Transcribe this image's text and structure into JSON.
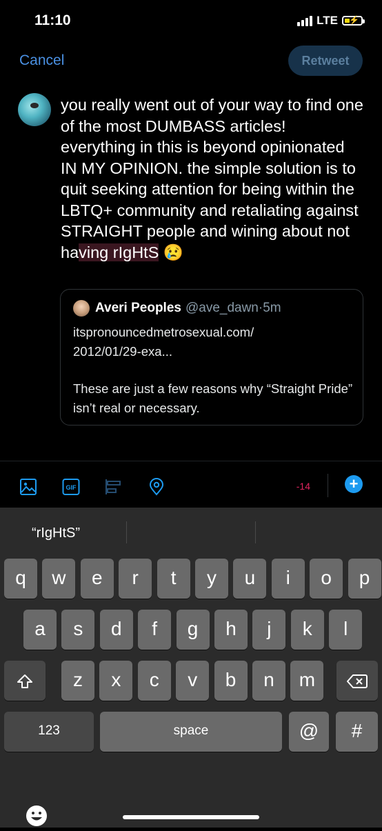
{
  "status": {
    "time": "11:10",
    "network": "LTE",
    "battery_level": 0.3,
    "battery_color": "#f5d90a"
  },
  "header": {
    "cancel_label": "Cancel",
    "retweet_label": "Retweet"
  },
  "composer": {
    "avatar_icon": "user-avatar",
    "text_main": "you really went out of your way to find one of the most DUMBASS articles! everything in this is beyond opinionated IN MY OPINION.  the simple solution is to quit seeking attention for being within the LBTQ+ community and retaliating against STRAIGHT people and wining about not ha",
    "text_highlight": "ving rIgHtS",
    "emoji": "😢"
  },
  "quote": {
    "name": "Averi Peoples",
    "handle": "@ave_dawn",
    "separator": "·",
    "time": "5m",
    "link_line1": "itspronouncedmetrosexual.com/",
    "link_line2": "2012/01/29-exa...",
    "body": "These are just a few reasons why “Straight Pride” isn’t real or necessary."
  },
  "toolbar": {
    "icons": [
      "image-icon",
      "gif-icon",
      "poll-icon",
      "location-icon"
    ],
    "gif_label": "GIF",
    "counter": "-14",
    "add_label": "+",
    "accent_color": "#1d9bf0",
    "counter_color": "#e0245e"
  },
  "keyboard": {
    "suggestions": [
      "“rIgHtS”",
      "",
      ""
    ],
    "row1": [
      "q",
      "w",
      "e",
      "r",
      "t",
      "y",
      "u",
      "i",
      "o",
      "p"
    ],
    "row2": [
      "a",
      "s",
      "d",
      "f",
      "g",
      "h",
      "j",
      "k",
      "l"
    ],
    "row3": [
      "z",
      "x",
      "c",
      "v",
      "b",
      "n",
      "m"
    ],
    "numbers_label": "123",
    "space_label": "space",
    "at_label": "@",
    "hash_label": "#"
  }
}
